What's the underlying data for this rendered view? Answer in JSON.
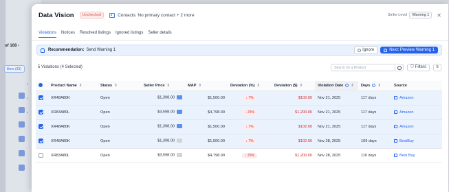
{
  "background": {
    "count_text": "of 108 -",
    "filter_text": "ilters (33)",
    "chevrons": [
      "›",
      "›",
      "›"
    ]
  },
  "header": {
    "title": "Data Vision",
    "status_badge": "Unchecked",
    "contacts_text": "Contacts: No primary contact + 2 more",
    "strike_level_label": "Strike Level",
    "strike_level_value": "Warning 1",
    "close_glyph": "✕"
  },
  "tabs": [
    {
      "label": "Violations",
      "active": true
    },
    {
      "label": "Notices"
    },
    {
      "label": "Resolved listings"
    },
    {
      "label": "Ignored listings"
    },
    {
      "label": "Seller details"
    }
  ],
  "recommendation": {
    "label": "Recommendation:",
    "value": "Send Warning 1",
    "ignore_label": "Ignore",
    "next_label": "Next: Preview Warning 1"
  },
  "toolbar": {
    "selection_text": "5 Violations (4 Selected)",
    "search_placeholder": "Search for a Product",
    "filters_label": "Filters"
  },
  "table": {
    "columns": [
      "Product Name",
      "Status",
      "Seller Price",
      "MAP",
      "Deviation (%)",
      "Deviation ($)",
      "Violation Date",
      "Days",
      "Source"
    ],
    "rows": [
      {
        "selected": true,
        "product": "XR48A80K",
        "status": "Open",
        "seller_price": "$1,398.00",
        "map": "$1,500.00",
        "dev_pct": "↓ 7%",
        "dev_usd": "$102.00",
        "date": "Nov 21, 2025",
        "days": "117 days",
        "source": "Amazon"
      },
      {
        "selected": true,
        "product": "XR83A80L",
        "status": "Open",
        "seller_price": "$3,598.00",
        "map": "$4,798.00",
        "dev_pct": "↓ 25%",
        "dev_usd": "$1,200.00",
        "date": "Nov 21, 2025",
        "days": "117 days",
        "source": "Amazon"
      },
      {
        "selected": true,
        "product": "XR48A80K",
        "status": "Open",
        "seller_price": "$1,398.00",
        "map": "$1,500.00",
        "dev_pct": "↓ 7%",
        "dev_usd": "$102.00",
        "date": "Nov 21, 2025",
        "days": "117 days",
        "source": "Amazon"
      },
      {
        "selected": true,
        "product": "XR48A80K",
        "status": "Open",
        "seller_price": "$1,398.00",
        "map": "$1,500.00",
        "dev_pct": "↓ 7%",
        "dev_usd": "$102.00",
        "date": "Nov 28, 2025",
        "days": "109 days",
        "source": "BestBuy"
      },
      {
        "selected": false,
        "product": "XR83A80L",
        "status": "Open",
        "seller_price": "$3,598.00",
        "map": "$4,798.00",
        "dev_pct": "↓ 25%",
        "dev_usd": "$1,200.00",
        "date": "Nov 28, 2025",
        "days": "110 days",
        "source": "Best Buy"
      }
    ]
  },
  "colors": {
    "accent": "#2563eb",
    "danger": "#dc2626",
    "selected_row": "#eaf2fe"
  }
}
